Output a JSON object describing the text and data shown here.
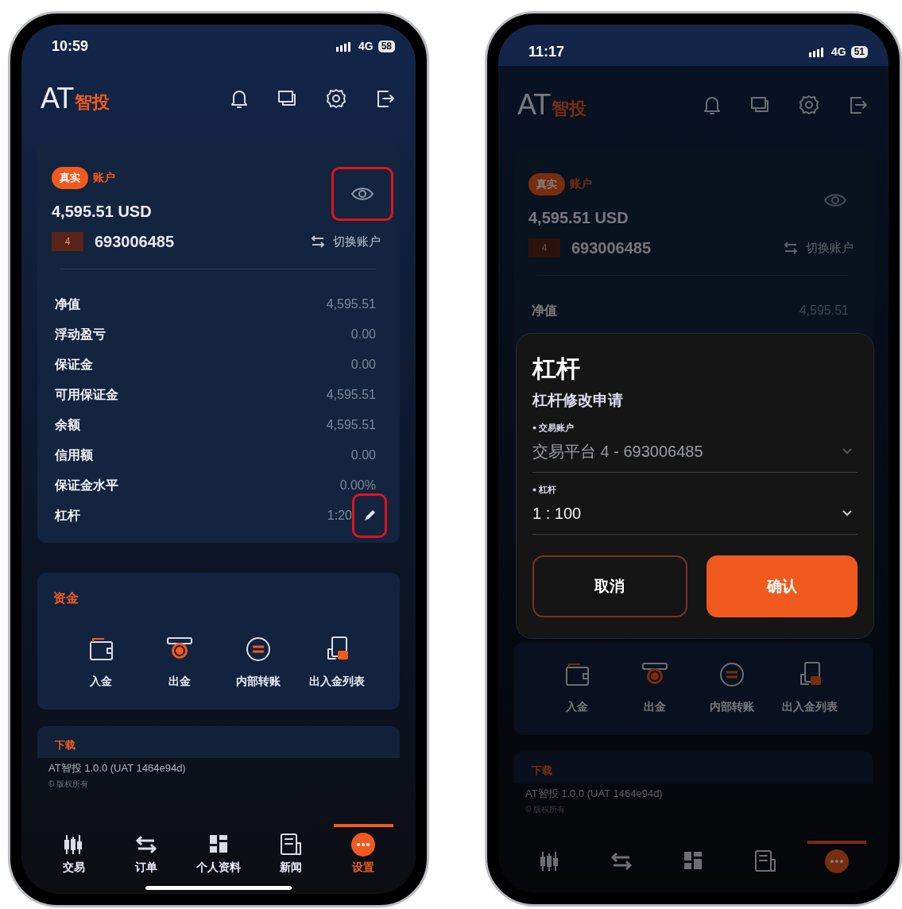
{
  "phones": [
    {
      "status_bar": {
        "time": "10:59",
        "network": "4G",
        "battery": "58"
      },
      "logo": {
        "text": "AT",
        "accent": "智投"
      },
      "account": {
        "badge": "真实",
        "label": "账户",
        "balance": "4,595.51 USD",
        "platform": "4",
        "number": "693006485",
        "switch": "切换账户",
        "eye_button": {
          "highlighted": true
        }
      },
      "details": [
        {
          "label": "净值",
          "value": "4,595.51",
          "editable": false
        },
        {
          "label": "浮动盈亏",
          "value": "0.00",
          "editable": false
        },
        {
          "label": "保证金",
          "value": "0.00",
          "editable": false
        },
        {
          "label": "可用保证金",
          "value": "4,595.51",
          "editable": false
        },
        {
          "label": "余额",
          "value": "4,595.51",
          "editable": false
        },
        {
          "label": "信用额",
          "value": "0.00",
          "editable": false
        },
        {
          "label": "保证金水平",
          "value": "0.00%",
          "editable": false
        },
        {
          "label": "杠杆",
          "value": "1:20",
          "editable": true,
          "edit_button": {
            "highlighted": true
          }
        }
      ],
      "funds": {
        "title": "资金",
        "actions": [
          {
            "label": "入金"
          },
          {
            "label": "出金"
          },
          {
            "label": "内部转账"
          },
          {
            "label": "出入金列表"
          }
        ]
      },
      "download": {
        "title": "下载",
        "version": "AT智投 1.0.0 (UAT 1464e94d)",
        "copyright": "© 版权所有"
      },
      "tabs": [
        {
          "label": "交易",
          "selected": false
        },
        {
          "label": "订单",
          "selected": false
        },
        {
          "label": "个人资料",
          "selected": false
        },
        {
          "label": "新闻",
          "selected": false
        },
        {
          "label": "设置",
          "selected": true
        }
      ]
    },
    {
      "status_bar": {
        "time": "11:17",
        "network": "4G",
        "battery": "51"
      },
      "logo": {
        "text": "AT",
        "accent": "智投"
      },
      "account": {
        "badge": "真实",
        "label": "账户",
        "balance": "4,595.51 USD",
        "platform": "4",
        "number": "693006485",
        "switch": "切换账户",
        "eye_button": {
          "highlighted": false
        }
      },
      "details": [
        {
          "label": "净值",
          "value": "4,595.51",
          "editable": false
        }
      ],
      "funds": {
        "actions": [
          {
            "label": "入金"
          },
          {
            "label": "出金"
          },
          {
            "label": "内部转账"
          },
          {
            "label": "出入金列表"
          }
        ]
      },
      "download": {
        "title": "下载",
        "version": "AT智投 1.0.0 (UAT 1464e94d)",
        "copyright": "© 版权所有"
      },
      "tabs": [
        {
          "selected": false
        },
        {
          "selected": false
        },
        {
          "selected": false
        },
        {
          "selected": false
        },
        {
          "selected": true
        }
      ],
      "dialog": {
        "title": "杠杆",
        "subtitle": "杠杆修改申请",
        "fields": [
          {
            "label": "交易账户",
            "value": "交易平台 4 - 693006485",
            "required": true,
            "disabled": true
          },
          {
            "label": "杠杆",
            "value": "1 : 100",
            "required": true,
            "disabled": false
          }
        ],
        "buttons": [
          {
            "label": "取消",
            "kind": "secondary"
          },
          {
            "label": "确认",
            "kind": "primary"
          }
        ]
      }
    }
  ]
}
